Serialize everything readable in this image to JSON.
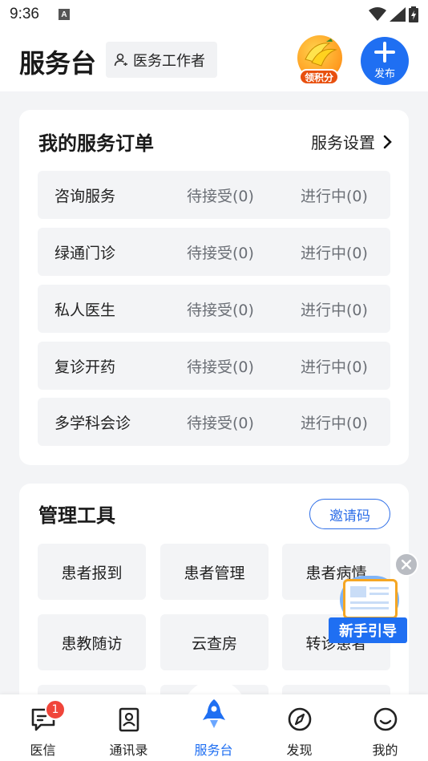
{
  "status_bar": {
    "time": "9:36"
  },
  "header": {
    "title": "服务台",
    "role": "医务工作者",
    "points_label": "领积分",
    "publish_label": "发布"
  },
  "orders": {
    "title": "我的服务订单",
    "settings": "服务设置",
    "rows": [
      {
        "name": "咨询服务",
        "pending": "待接受(0)",
        "in_progress": "进行中(0)"
      },
      {
        "name": "绿通门诊",
        "pending": "待接受(0)",
        "in_progress": "进行中(0)"
      },
      {
        "name": "私人医生",
        "pending": "待接受(0)",
        "in_progress": "进行中(0)"
      },
      {
        "name": "复诊开药",
        "pending": "待接受(0)",
        "in_progress": "进行中(0)"
      },
      {
        "name": "多学科会诊",
        "pending": "待接受(0)",
        "in_progress": "进行中(0)"
      }
    ]
  },
  "tools": {
    "title": "管理工具",
    "invite": "邀请码",
    "items": [
      "患者报到",
      "患者管理",
      "患者病情",
      "患教随访",
      "云查房",
      "转诊患者"
    ]
  },
  "guide": {
    "label": "新手引导"
  },
  "tabbar": {
    "items": [
      {
        "label": "医信",
        "badge": "1"
      },
      {
        "label": "通讯录"
      },
      {
        "label": "服务台"
      },
      {
        "label": "发现"
      },
      {
        "label": "我的"
      }
    ],
    "active_color": "#1f6ff2"
  }
}
